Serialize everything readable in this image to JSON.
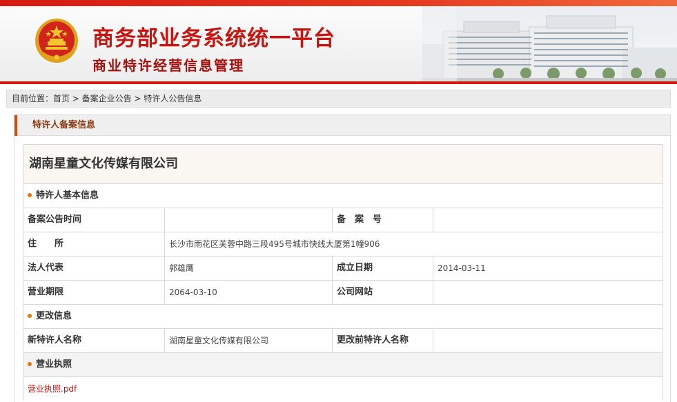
{
  "header": {
    "title": "商务部业务系统统一平台",
    "subtitle": "商业特许经营信息管理",
    "colors": {
      "brand_red": "#c8140f",
      "accent_orange": "#d84b0f"
    }
  },
  "breadcrumb": {
    "text": "目前位置：首页 > 备案企业公告 > 特许人公告信息"
  },
  "panel": {
    "title": "特许人备案信息"
  },
  "company": {
    "name": "湖南星童文化传媒有限公司"
  },
  "basic_info": {
    "section_title": "特许人基本信息",
    "rows": [
      {
        "label1": "备案公告时间",
        "value1": "",
        "label2": "备　案　号",
        "value2": ""
      },
      {
        "label1": "住　　所",
        "value1": "长沙市雨花区芙蓉中路三段495号城市快线大厦第1幢906"
      },
      {
        "label1": "法人代表",
        "value1": "郭雄鹰",
        "label2": "成立日期",
        "value2": "2014-03-11"
      },
      {
        "label1": "营业期限",
        "value1": "2064-03-10",
        "label2": "公司网站",
        "value2": ""
      }
    ]
  },
  "change_info": {
    "section_title": "更改信息",
    "label1": "新特许人名称",
    "value1": "湖南星童文化传媒有限公司",
    "label2": "更改前特许人名称",
    "value2": ""
  },
  "license": {
    "section_title": "营业执照",
    "file_link": "营业执照.pdf"
  }
}
